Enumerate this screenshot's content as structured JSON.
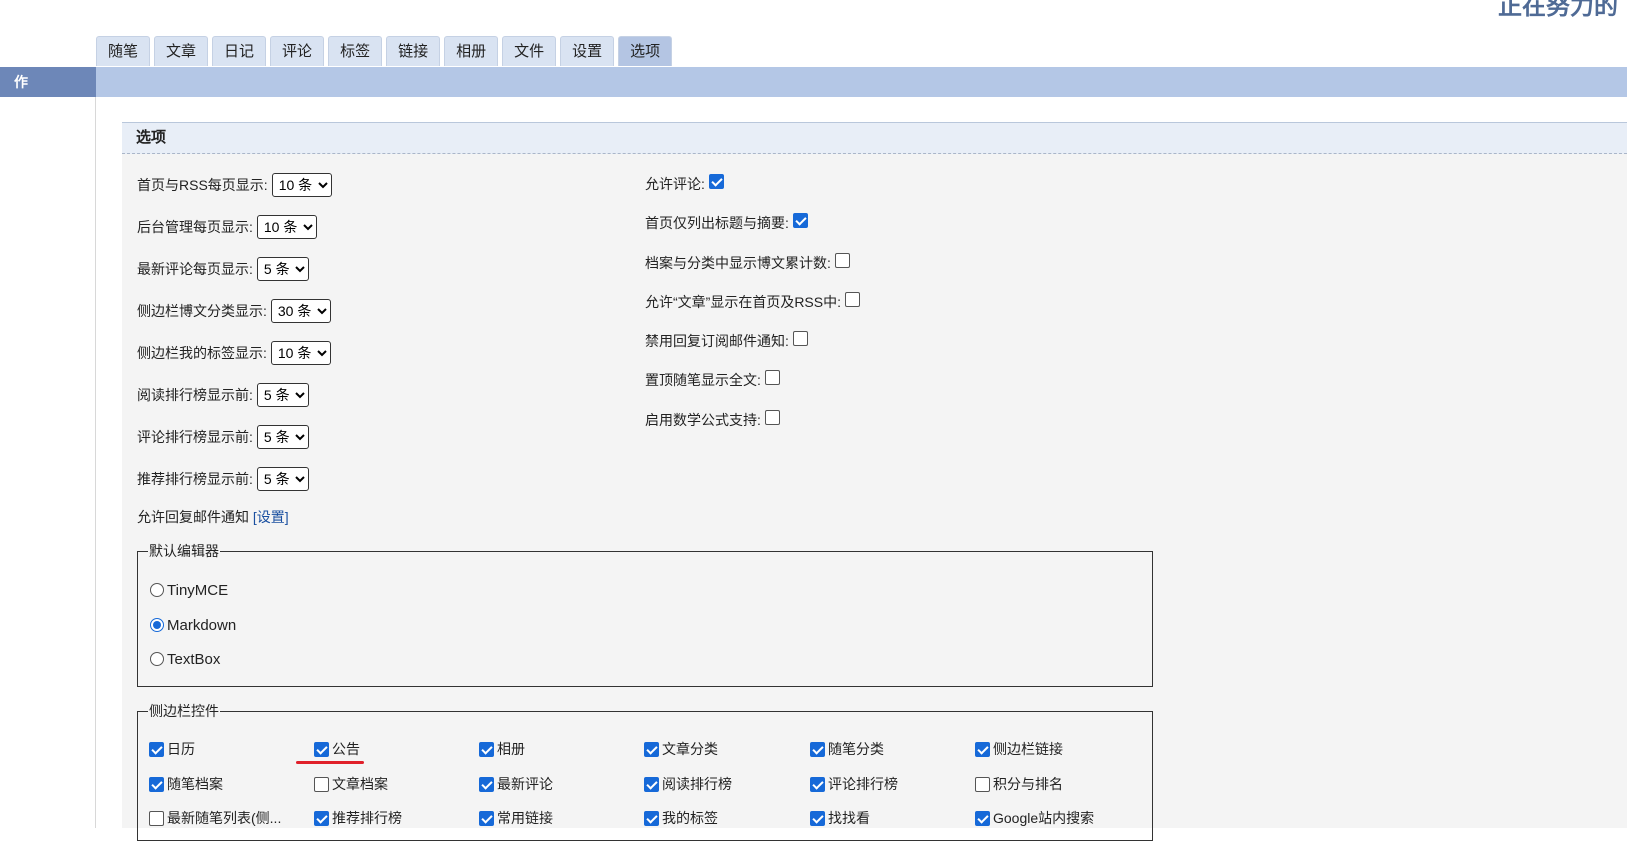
{
  "site_title": "正在努力的",
  "tabs": [
    "随笔",
    "文章",
    "日记",
    "评论",
    "标签",
    "链接",
    "相册",
    "文件",
    "设置",
    "选项"
  ],
  "active_tab": "选项",
  "left_label": "作",
  "panel_title": "选项",
  "left_options": [
    {
      "label": "首页与RSS每页显示:",
      "value": "10 条"
    },
    {
      "label": "后台管理每页显示:",
      "value": "10 条"
    },
    {
      "label": "最新评论每页显示:",
      "value": "5 条"
    },
    {
      "label": "侧边栏博文分类显示:",
      "value": "30 条"
    },
    {
      "label": "侧边栏我的标签显示:",
      "value": "10 条"
    },
    {
      "label": "阅读排行榜显示前:",
      "value": "5 条"
    },
    {
      "label": "评论排行榜显示前:",
      "value": "5 条"
    },
    {
      "label": "推荐排行榜显示前:",
      "value": "5 条"
    }
  ],
  "right_options": [
    {
      "label": "允许评论:",
      "checked": true
    },
    {
      "label": "首页仅列出标题与摘要:",
      "checked": true
    },
    {
      "label": "档案与分类中显示博文累计数:",
      "checked": false
    },
    {
      "label": "允许“文章”显示在首页及RSS中:",
      "checked": false
    },
    {
      "label": "禁用回复订阅邮件通知:",
      "checked": false
    },
    {
      "label": "置顶随笔显示全文:",
      "checked": false
    },
    {
      "label": "启用数学公式支持:",
      "checked": false
    }
  ],
  "reply_notify": {
    "label": "允许回复邮件通知",
    "link": "[设置]"
  },
  "editor": {
    "legend": "默认编辑器",
    "options": [
      {
        "label": "TinyMCE",
        "selected": false
      },
      {
        "label": "Markdown",
        "selected": true
      },
      {
        "label": "TextBox",
        "selected": false
      }
    ]
  },
  "sidebar": {
    "legend": "侧边栏控件",
    "items": [
      {
        "label": "日历",
        "checked": true
      },
      {
        "label": "公告",
        "checked": true
      },
      {
        "label": "相册",
        "checked": true
      },
      {
        "label": "文章分类",
        "checked": true
      },
      {
        "label": "随笔分类",
        "checked": true
      },
      {
        "label": "侧边栏链接",
        "checked": true
      },
      {
        "label": "随笔档案",
        "checked": true
      },
      {
        "label": "文章档案",
        "checked": false
      },
      {
        "label": "最新评论",
        "checked": true
      },
      {
        "label": "阅读排行榜",
        "checked": true
      },
      {
        "label": "评论排行榜",
        "checked": true
      },
      {
        "label": "积分与排名",
        "checked": false
      },
      {
        "label": "最新随笔列表(侧...",
        "checked": false
      },
      {
        "label": "推荐排行榜",
        "checked": true
      },
      {
        "label": "常用链接",
        "checked": true
      },
      {
        "label": "我的标签",
        "checked": true
      },
      {
        "label": "找找看",
        "checked": true
      },
      {
        "label": "Google站内搜索",
        "checked": true
      }
    ]
  },
  "colors": {
    "accent": "#1669d8",
    "tab_bg": "#d9e3f2",
    "bar": "#b4c7e6",
    "annotation": "#e0202a"
  }
}
